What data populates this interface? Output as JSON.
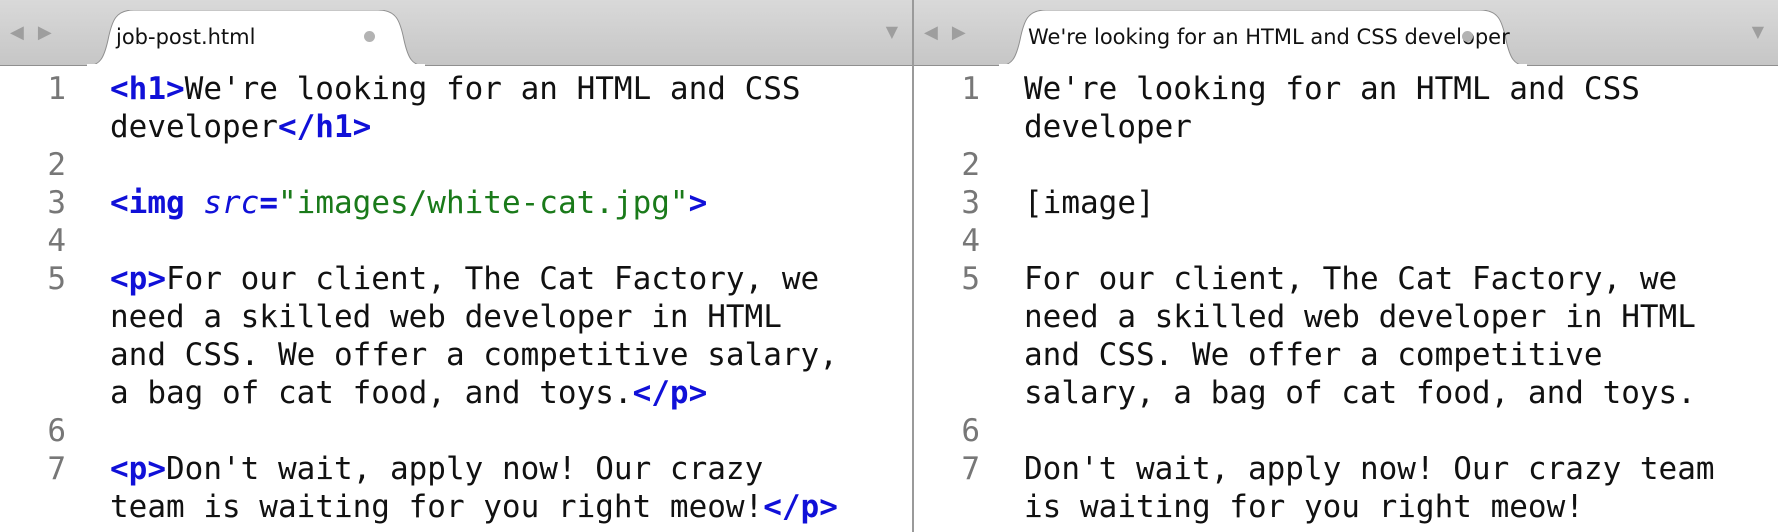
{
  "nav": {
    "back_glyph": "◀",
    "forward_glyph": "▶",
    "menu_glyph": "▼"
  },
  "left": {
    "tab_title": "job-post.html",
    "lines": [
      {
        "num": "1",
        "parts": [
          {
            "t": "<h1>",
            "c": "tag"
          },
          {
            "t": "We're looking for an HTML and CSS",
            "c": ""
          }
        ]
      },
      {
        "num": "",
        "parts": [
          {
            "t": "developer",
            "c": ""
          },
          {
            "t": "</h1>",
            "c": "tag"
          }
        ]
      },
      {
        "num": "2",
        "parts": []
      },
      {
        "num": "3",
        "parts": [
          {
            "t": "<img ",
            "c": "tag"
          },
          {
            "t": "src",
            "c": "attr"
          },
          {
            "t": "=",
            "c": "tag"
          },
          {
            "t": "\"images/white-cat.jpg\"",
            "c": "str"
          },
          {
            "t": ">",
            "c": "tag"
          }
        ]
      },
      {
        "num": "4",
        "parts": []
      },
      {
        "num": "5",
        "parts": [
          {
            "t": "<p>",
            "c": "tag"
          },
          {
            "t": "For our client, The Cat Factory, we",
            "c": ""
          }
        ]
      },
      {
        "num": "",
        "parts": [
          {
            "t": "need a skilled web developer in HTML",
            "c": ""
          }
        ]
      },
      {
        "num": "",
        "parts": [
          {
            "t": "and CSS. We offer a competitive salary,",
            "c": ""
          }
        ]
      },
      {
        "num": "",
        "parts": [
          {
            "t": "a bag of cat food, and toys.",
            "c": ""
          },
          {
            "t": "</p>",
            "c": "tag"
          }
        ]
      },
      {
        "num": "6",
        "parts": []
      },
      {
        "num": "7",
        "parts": [
          {
            "t": "<p>",
            "c": "tag"
          },
          {
            "t": "Don't wait, apply now! Our crazy",
            "c": ""
          }
        ]
      },
      {
        "num": "",
        "parts": [
          {
            "t": "team is waiting for you right meow!",
            "c": ""
          },
          {
            "t": "</p>",
            "c": "tag"
          }
        ]
      }
    ]
  },
  "right": {
    "tab_title": "We're looking for an HTML and CSS developer",
    "lines": [
      {
        "num": "1",
        "parts": [
          {
            "t": "We're looking for an HTML and CSS",
            "c": ""
          }
        ]
      },
      {
        "num": "",
        "parts": [
          {
            "t": "developer",
            "c": ""
          }
        ]
      },
      {
        "num": "2",
        "parts": []
      },
      {
        "num": "3",
        "parts": [
          {
            "t": "[image]",
            "c": ""
          }
        ]
      },
      {
        "num": "4",
        "parts": []
      },
      {
        "num": "5",
        "parts": [
          {
            "t": "For our client, The Cat Factory, we",
            "c": ""
          }
        ]
      },
      {
        "num": "",
        "parts": [
          {
            "t": "need a skilled web developer in HTML",
            "c": ""
          }
        ]
      },
      {
        "num": "",
        "parts": [
          {
            "t": "and CSS. We offer a competitive",
            "c": ""
          }
        ]
      },
      {
        "num": "",
        "parts": [
          {
            "t": "salary, a bag of cat food, and toys.",
            "c": ""
          }
        ]
      },
      {
        "num": "6",
        "parts": []
      },
      {
        "num": "7",
        "parts": [
          {
            "t": "Don't wait, apply now! Our crazy team",
            "c": ""
          }
        ]
      },
      {
        "num": "",
        "parts": [
          {
            "t": "is waiting for you right meow!",
            "c": ""
          }
        ]
      }
    ]
  }
}
